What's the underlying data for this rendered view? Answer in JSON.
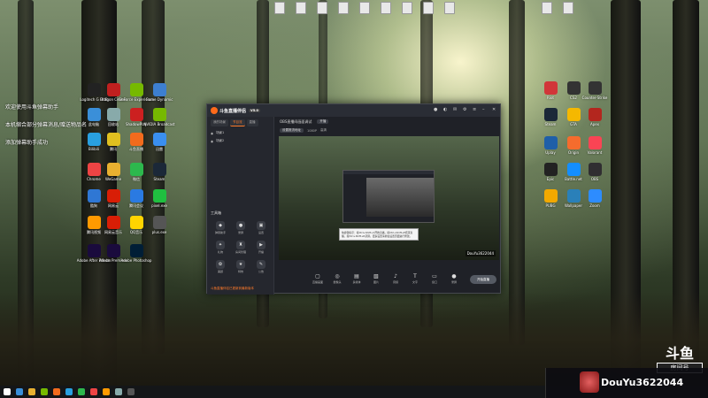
{
  "overlay_messages": [
    "欢迎使用斗鱼弹幕助手",
    "本机缩合部分弹幕消息/赠送物品名",
    "添加弹幕助手成功"
  ],
  "desktop_icons": [
    {
      "label": "Logitech G HUB",
      "icon": "logitech-icon",
      "color": "#222"
    },
    {
      "label": "Dragon Center",
      "icon": "dragon-icon",
      "color": "#c0201f"
    },
    {
      "label": "GeForce Experience",
      "icon": "geforce-icon",
      "color": "#76b900"
    },
    {
      "label": "Game Dynamic",
      "icon": "game-icon",
      "color": "#3d7fd0"
    },
    {
      "label": "此电脑",
      "icon": "computer-icon",
      "color": "#3a8fd9"
    },
    {
      "label": "回收站",
      "icon": "recycle-icon",
      "color": "#8aa"
    },
    {
      "label": "ShadowPlay",
      "icon": "shadowplay-icon",
      "color": "#cc2020"
    },
    {
      "label": "NVIDIA Broadcast",
      "icon": "nvidia-icon",
      "color": "#76b900"
    },
    {
      "label": "Bilibili",
      "icon": "bili-icon",
      "color": "#29a0e0"
    },
    {
      "label": "腾讯",
      "icon": "qq-icon",
      "color": "#e0c020"
    },
    {
      "label": "斗鱼直播",
      "icon": "douyu-icon",
      "color": "#f26b1d"
    },
    {
      "label": "迅雷",
      "icon": "xunlei-icon",
      "color": "#3a8ff0"
    },
    {
      "label": "Chrome",
      "icon": "chrome-icon",
      "color": "#e44"
    },
    {
      "label": "WeGame",
      "icon": "wegame-icon",
      "color": "#e8b030"
    },
    {
      "label": "微信",
      "icon": "wechat-icon",
      "color": "#2db84d"
    },
    {
      "label": "Steam",
      "icon": "steam-icon",
      "color": "#1b2838"
    },
    {
      "label": "酷狗",
      "icon": "kugou-icon",
      "color": "#2f77d4"
    },
    {
      "label": "网易云",
      "icon": "music-icon",
      "color": "#d81e06"
    },
    {
      "label": "腾讯会议",
      "icon": "meeting-icon",
      "color": "#2a7ae2"
    },
    {
      "label": "pixel.exe",
      "icon": "pixel-icon",
      "color": "#20c040"
    },
    {
      "label": "腾讯视频",
      "icon": "video-icon",
      "color": "#ff9a00"
    },
    {
      "label": "网易云音乐",
      "icon": "netease-icon",
      "color": "#d81e06"
    },
    {
      "label": "QQ音乐",
      "icon": "qqmusic-icon",
      "color": "#ffd400"
    },
    {
      "label": "plus.exe",
      "icon": "plus-icon",
      "color": "#555"
    },
    {
      "label": "Adobe After Effects",
      "icon": "ae-icon",
      "color": "#1a0b3d"
    },
    {
      "label": "Adobe Premiere",
      "icon": "pr-icon",
      "color": "#1a0b3d"
    },
    {
      "label": "Adobe Photoshop",
      "icon": "ps-icon",
      "color": "#001e36"
    }
  ],
  "right_icons": [
    {
      "label": "Riot",
      "icon": "riot-icon",
      "color": "#d13639"
    },
    {
      "label": "CS2",
      "icon": "cs-icon",
      "color": "#333"
    },
    {
      "label": "Counter-Strike",
      "icon": "cs-icon",
      "color": "#333"
    },
    {
      "label": "Steam",
      "icon": "steam-icon",
      "color": "#1b2838"
    },
    {
      "label": "GTA",
      "icon": "rockstar-icon",
      "color": "#f5b800"
    },
    {
      "label": "Apex",
      "icon": "apex-icon",
      "color": "#b3261e"
    },
    {
      "label": "Uplay",
      "icon": "uplay-icon",
      "color": "#1f5fa8"
    },
    {
      "label": "Origin",
      "icon": "origin-icon",
      "color": "#f56c2d"
    },
    {
      "label": "Valorant",
      "icon": "valorant-icon",
      "color": "#fa4454"
    },
    {
      "label": "Epic",
      "icon": "epic-icon",
      "color": "#222"
    },
    {
      "label": "Battle.net",
      "icon": "battle-icon",
      "color": "#148eff"
    },
    {
      "label": "OBS",
      "icon": "obs-icon",
      "color": "#302e31"
    },
    {
      "label": "PUBG",
      "icon": "pubg-icon",
      "color": "#f2a900"
    },
    {
      "label": "Wallpaper",
      "icon": "wallpaper-icon",
      "color": "#2a80b9"
    },
    {
      "label": "Zoom",
      "icon": "zoom-icon",
      "color": "#2d8cff"
    }
  ],
  "app": {
    "name": "斗鱼直播伴侣",
    "version": "V5.0",
    "tabs": [
      "我的场景",
      "节目流",
      "直播"
    ],
    "scenes": [
      "场景1",
      "场景2"
    ],
    "tools_title": "工具箱",
    "tools": [
      "弹幕助手",
      "录屏",
      "设置",
      "礼物",
      "房间管理",
      "开播",
      "美颜",
      "特效",
      "公告"
    ],
    "footer": "斗鱼直播伴侣已更新到最新版本",
    "main_title": "OBS直播间画面调试",
    "main_btn": "开播",
    "sub_pill": "设置推流地址",
    "sub_labels": [
      "1080P",
      "高清"
    ],
    "tooltip": "快捷键提示：按Ctrl+Shift+S开始直播，按Ctrl+Shift+E结束直播，按Ctrl+Shift+R录屏。更多设置请前往设置页面进行修改。",
    "watermark": "DouYu3622044",
    "controls": [
      "直播画面",
      "摄像头",
      "多媒体",
      "图片",
      "音频",
      "文字",
      "窗口",
      "录屏"
    ],
    "start_label": "开始直播"
  },
  "douyu": {
    "logo": "斗鱼",
    "room_label": "房间号",
    "room": "DouYu3622044"
  },
  "taskbar_colors": [
    "#3a8fd9",
    "#e8b030",
    "#76b900",
    "#f26b1d",
    "#29a0e0",
    "#2db84d",
    "#e44",
    "#ff9a00",
    "#8aa",
    "#555"
  ]
}
